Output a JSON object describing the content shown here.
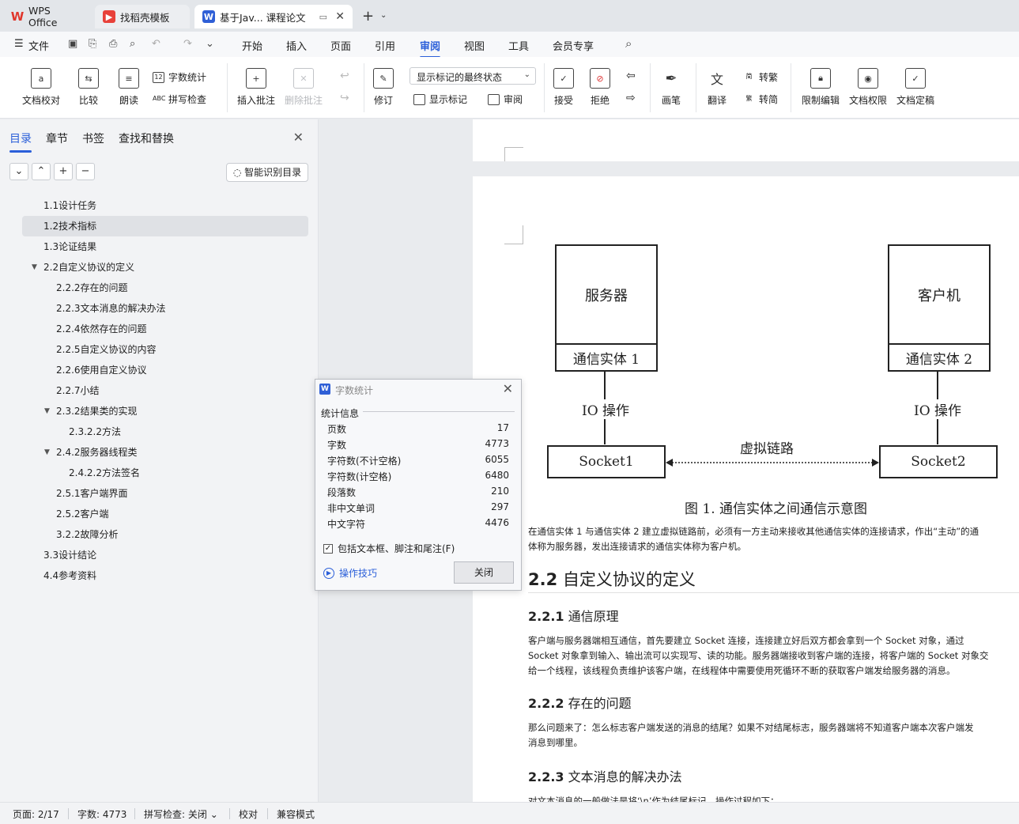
{
  "tabs": {
    "wps_label": "WPS Office",
    "template_label": "找稻壳模板",
    "doc_label": "基于Jav... 课程论文"
  },
  "menu": {
    "file": "文件",
    "items": [
      "开始",
      "插入",
      "页面",
      "引用",
      "审阅",
      "视图",
      "工具",
      "会员专享"
    ],
    "active": "审阅"
  },
  "ribbon": {
    "doc_proof": "文档校对",
    "compare": "比较",
    "read_aloud": "朗读",
    "word_count": "字数统计",
    "spell_check": "拼写检查",
    "insert_comment": "插入批注",
    "delete_comment": "删除批注",
    "track_changes": "修订",
    "markup_state": "显示标记的最终状态",
    "show_markup": "显示标记",
    "review": "审阅",
    "accept": "接受",
    "reject": "拒绝",
    "pen": "画笔",
    "translate": "翻译",
    "to_traditional": "转繁",
    "to_simplified": "转简",
    "restrict_edit": "限制编辑",
    "doc_permission": "文档权限",
    "doc_finalize": "文档定稿"
  },
  "panel": {
    "tabs": [
      "目录",
      "章节",
      "书签",
      "查找和替换"
    ],
    "smart_toc": "智能识别目录",
    "toc": [
      {
        "label": "1.1设计任务",
        "level": 1,
        "selected": false,
        "arrow": ""
      },
      {
        "label": "1.2技术指标",
        "level": 1,
        "selected": true,
        "arrow": ""
      },
      {
        "label": "1.3论证结果",
        "level": 1,
        "selected": false,
        "arrow": ""
      },
      {
        "label": "2.2自定义协议的定义",
        "level": 1,
        "selected": false,
        "arrow": "▼"
      },
      {
        "label": "2.2.2存在的问题",
        "level": 2,
        "selected": false,
        "arrow": ""
      },
      {
        "label": "2.2.3文本消息的解决办法",
        "level": 2,
        "selected": false,
        "arrow": ""
      },
      {
        "label": "2.2.4依然存在的问题",
        "level": 2,
        "selected": false,
        "arrow": ""
      },
      {
        "label": "2.2.5自定义协议的内容",
        "level": 2,
        "selected": false,
        "arrow": ""
      },
      {
        "label": "2.2.6使用自定义协议",
        "level": 2,
        "selected": false,
        "arrow": ""
      },
      {
        "label": "2.2.7小结",
        "level": 2,
        "selected": false,
        "arrow": ""
      },
      {
        "label": "2.3.2结果类的实现",
        "level": 2,
        "selected": false,
        "arrow": "▼"
      },
      {
        "label": "2.3.2.2方法",
        "level": 3,
        "selected": false,
        "arrow": ""
      },
      {
        "label": "2.4.2服务器线程类",
        "level": 2,
        "selected": false,
        "arrow": "▼"
      },
      {
        "label": "2.4.2.2方法签名",
        "level": 3,
        "selected": false,
        "arrow": ""
      },
      {
        "label": "2.5.1客户端界面",
        "level": 2,
        "selected": false,
        "arrow": ""
      },
      {
        "label": "2.5.2客户端",
        "level": 2,
        "selected": false,
        "arrow": ""
      },
      {
        "label": "3.2.2故障分析",
        "level": 2,
        "selected": false,
        "arrow": ""
      },
      {
        "label": "3.3设计结论",
        "level": 1,
        "selected": false,
        "arrow": ""
      },
      {
        "label": "4.4参考资料",
        "level": 1,
        "selected": false,
        "arrow": ""
      }
    ]
  },
  "document": {
    "diagram": {
      "server": "服务器",
      "client": "客户机",
      "entity1": "通信实体 1",
      "entity2": "通信实体 2",
      "io1": "IO 操作",
      "io2": "IO 操作",
      "socket1": "Socket1",
      "socket2": "Socket2",
      "link": "虚拟链路",
      "caption": "图 1. 通信实体之间通信示意图"
    },
    "para1_l1": "在通信实体 1 与通信实体 2 建立虚拟链路前，必须有一方主动来接收其他通信实体的连接请求，作出“主动”的通",
    "para1_l2": "体称为服务器，发出连接请求的通信实体称为客户机。",
    "h2_num": "2.2",
    "h2_text": "自定义协议的定义",
    "h3a_num": "2.2.1",
    "h3a_text": "通信原理",
    "para2_l1": "客户端与服务器端相互通信，首先要建立 Socket 连接，连接建立好后双方都会拿到一个 Socket 对象，通过",
    "para2_l2": "Socket 对象拿到输入、输出流可以实现写、读的功能。服务器端接收到客户端的连接，将客户端的 Socket 对象交",
    "para2_l3": "给一个线程，该线程负责维护该客户端，在线程体中需要使用死循环不断的获取客户端发给服务器的消息。",
    "h3b_num": "2.2.2",
    "h3b_text": "存在的问题",
    "para3_l1": "那么问题来了：怎么标志客户端发送的消息的结尾？如果不对结尾标志，服务器端将不知道客户端本次客户端发",
    "para3_l2": "消息到哪里。",
    "h3c_num": "2.2.3",
    "h3c_text": "文本消息的解决办法",
    "para4_l1": "对文本消息的一般做法是将‘\\n’作为结尾标记，操作过程如下："
  },
  "dialog": {
    "title": "字数统计",
    "section": "统计信息",
    "stats": [
      {
        "label": "页数",
        "value": "17"
      },
      {
        "label": "字数",
        "value": "4773"
      },
      {
        "label": "字符数(不计空格)",
        "value": "6055"
      },
      {
        "label": "字符数(计空格)",
        "value": "6480"
      },
      {
        "label": "段落数",
        "value": "210"
      },
      {
        "label": "非中文单词",
        "value": "297"
      },
      {
        "label": "中文字符",
        "value": "4476"
      }
    ],
    "include_label": "包括文本框、脚注和尾注(F)",
    "include_checked": true,
    "tips": "操作技巧",
    "close": "关闭"
  },
  "status": {
    "page": "页面: 2/17",
    "words": "字数: 4773",
    "spell": "拼写检查: 关闭",
    "proof": "校对",
    "compat": "兼容模式"
  }
}
